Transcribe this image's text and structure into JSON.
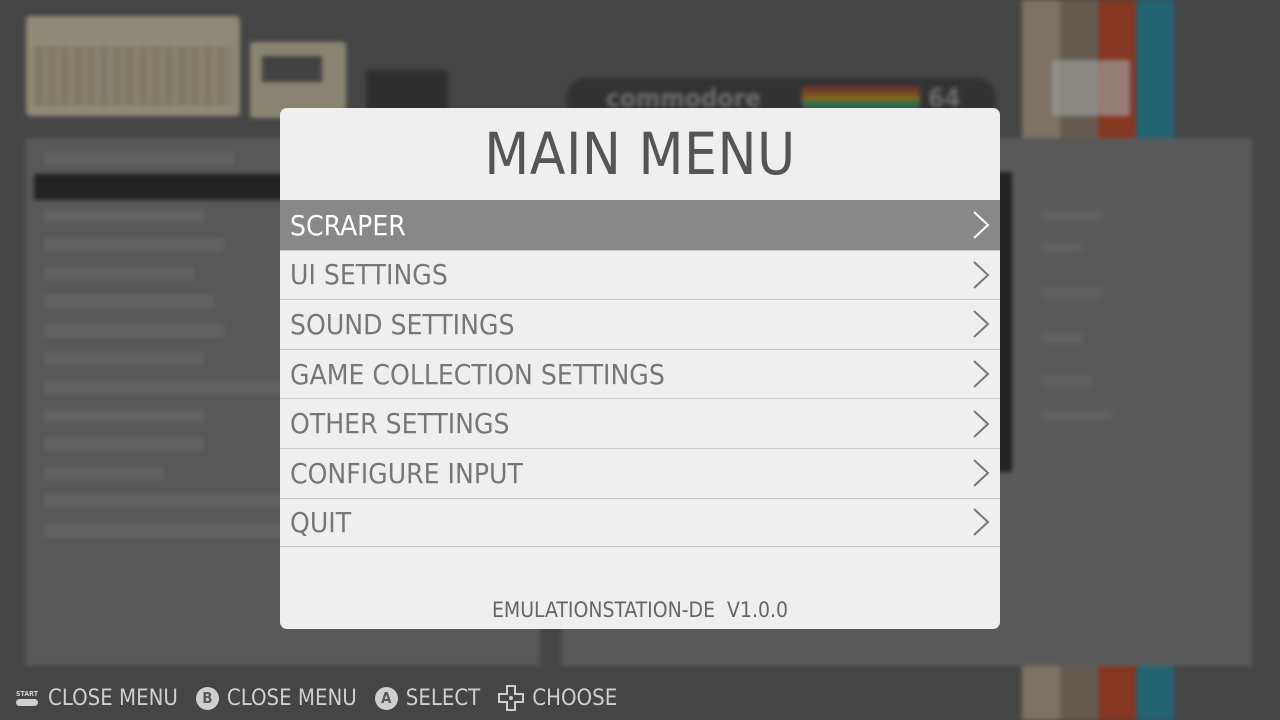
{
  "background": {
    "logo_text": "commodore",
    "logo_number": "64"
  },
  "menu": {
    "title": "MAIN MENU",
    "items": [
      {
        "label": "SCRAPER",
        "active": true
      },
      {
        "label": "UI SETTINGS",
        "active": false
      },
      {
        "label": "SOUND SETTINGS",
        "active": false
      },
      {
        "label": "GAME COLLECTION SETTINGS",
        "active": false
      },
      {
        "label": "OTHER SETTINGS",
        "active": false
      },
      {
        "label": "CONFIGURE INPUT",
        "active": false
      },
      {
        "label": "QUIT",
        "active": false
      }
    ],
    "version": "EMULATIONSTATION-DE  V1.0.0"
  },
  "help": {
    "start_label": "CLOSE MENU",
    "start_cap": "START",
    "b_button": "B",
    "b_label": "CLOSE MENU",
    "a_button": "A",
    "a_label": "SELECT",
    "dpad_label": "CHOOSE"
  },
  "colors": {
    "dialog_bg": "#efefef",
    "selected_row": "#888888",
    "text": "#777777",
    "title": "#555555",
    "help_text": "#cfcfcf"
  }
}
